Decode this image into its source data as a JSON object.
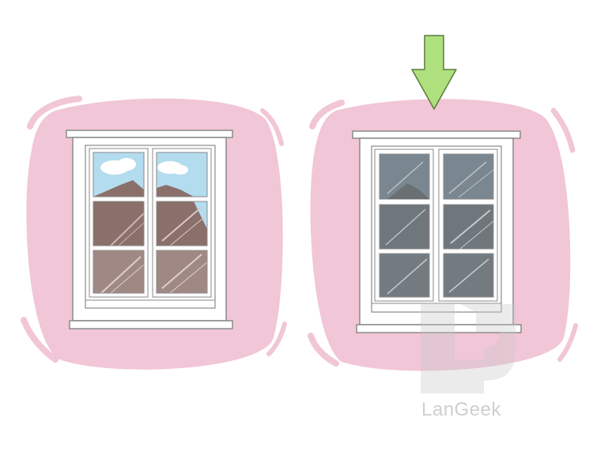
{
  "colors": {
    "blob": "#f1c6d6",
    "blob_stroke": "#e8b3c6",
    "frame": "#ffffff",
    "frame_stroke": "#8a8a8a",
    "sky": "#b4dcef",
    "cloud": "#ffffff",
    "mountain": "#8a6f6a",
    "tinted_glass": "#6f7d86",
    "arrow": "#aee07e",
    "arrow_stroke": "#5c7a3c",
    "watermark": "#d9d9d9"
  },
  "icons": {
    "arrow": "arrow-down-icon",
    "logo": "langeek-logo-icon"
  },
  "panels": [
    {
      "name": "clear-window",
      "glass": "clear"
    },
    {
      "name": "tinted-window",
      "glass": "tinted"
    }
  ],
  "watermark": {
    "text": "LanGeek"
  }
}
